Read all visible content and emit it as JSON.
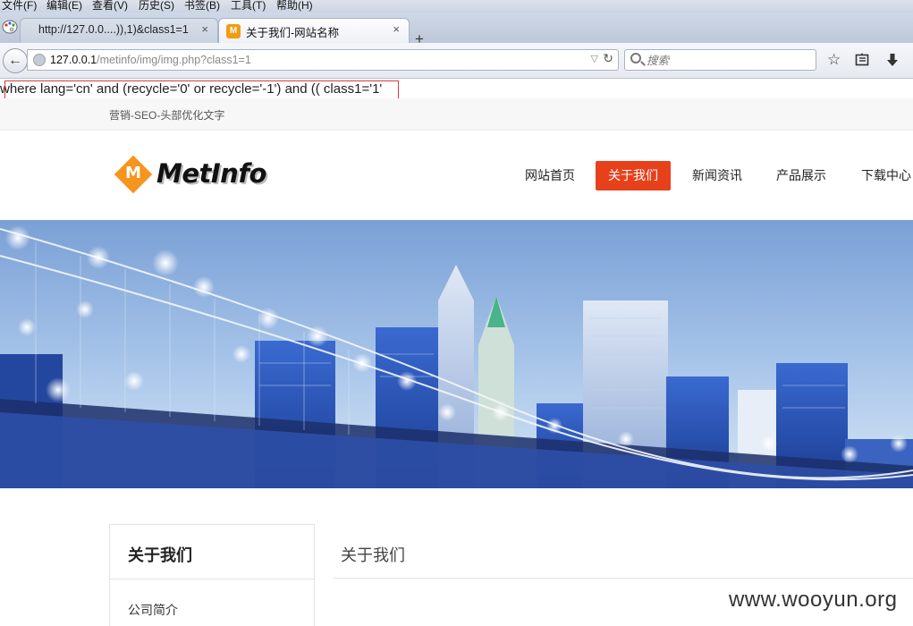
{
  "browser": {
    "menu": [
      "文件(F)",
      "编辑(E)",
      "查看(V)",
      "历史(S)",
      "书签(B)",
      "工具(T)",
      "帮助(H)"
    ],
    "tabs": [
      {
        "title": "http://127.0.0....)),1)&class1=1",
        "close": "×"
      },
      {
        "title": "关于我们-网站名称",
        "close": "×",
        "favicon": "M"
      }
    ],
    "new_tab": "+",
    "url_host": "127.0.0.1",
    "url_path": "/metinfo/img/img.php?class1=1",
    "search_placeholder": "搜索"
  },
  "page": {
    "sql_output": "where lang='cn' and (recycle='0' or recycle='-1') and (( class1='1'",
    "slogan": "营销-SEO-头部优化文字",
    "logo_text": "MetInfo",
    "logo_mark": "M",
    "nav": [
      {
        "label": "网站首页",
        "active": false
      },
      {
        "label": "关于我们",
        "active": true
      },
      {
        "label": "新闻资讯",
        "active": false
      },
      {
        "label": "产品展示",
        "active": false
      },
      {
        "label": "下载中心",
        "active": false
      }
    ],
    "sidebar_title": "关于我们",
    "sidebar_item": "公司简介",
    "main_title": "关于我们",
    "watermark": "www.wooyun.org"
  },
  "colors": {
    "nav_active": "#e7411c",
    "logo_orange": "#f7941d",
    "sql_box": "#d23c3c"
  }
}
